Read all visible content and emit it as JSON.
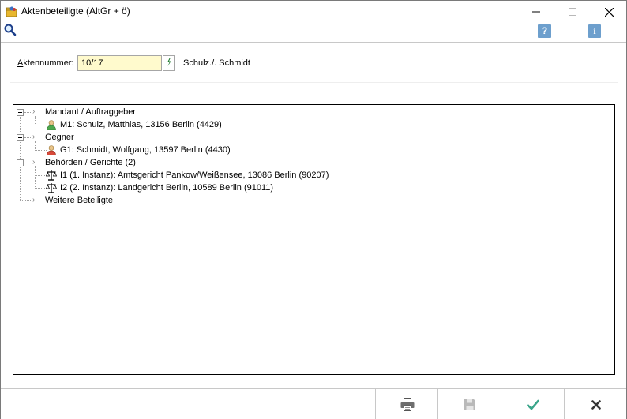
{
  "window": {
    "title": "Aktenbeteiligte (AltGr + ö)",
    "minimize_symbol": "—",
    "maximize_symbol": "☐",
    "close_symbol": "✕"
  },
  "toolbar": {
    "search_icon": "magnifier-icon",
    "help_label": "?",
    "info_label": "i"
  },
  "akte": {
    "label_underlined": "A",
    "label_rest": "ktennummer:",
    "value": "10/17",
    "name": "Schulz./. Schmidt"
  },
  "tree": {
    "groups": [
      {
        "label": "Mandant / Auftraggeber",
        "children": [
          {
            "label": "M1: Schulz, Matthias, 13156 Berlin (4429)",
            "icon": "person-green-icon"
          }
        ]
      },
      {
        "label": "Gegner",
        "children": [
          {
            "label": "G1: Schmidt, Wolfgang, 13597 Berlin (4430)",
            "icon": "person-red-icon"
          }
        ]
      },
      {
        "label": "Behörden / Gerichte (2)",
        "children": [
          {
            "label": "I1 (1. Instanz): Amtsgericht Pankow/Weißensee, 13086 Berlin (90207)",
            "icon": "court-scales-icon"
          },
          {
            "label": "I2 (2. Instanz): Landgericht Berlin, 10589 Berlin (91011)",
            "icon": "court-scales-icon"
          }
        ]
      },
      {
        "label": "Weitere Beteiligte",
        "children": []
      }
    ]
  },
  "bottom": {
    "print_icon": "printer-icon",
    "save_icon": "save-icon",
    "ok_icon": "checkmark-icon",
    "cancel_icon": "cross-icon"
  },
  "colors": {
    "input_bg": "#fffacd",
    "info_blue": "#6d9fcd",
    "ok_green": "#3aa58a",
    "cancel_dark": "#333333"
  }
}
